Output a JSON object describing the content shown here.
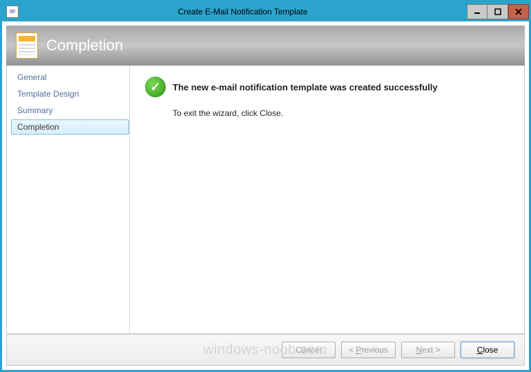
{
  "window": {
    "title": "Create E-Mail Notification Template"
  },
  "banner": {
    "title": "Completion"
  },
  "sidebar": {
    "items": [
      {
        "label": "General",
        "active": false
      },
      {
        "label": "Template Design",
        "active": false
      },
      {
        "label": "Summary",
        "active": false
      },
      {
        "label": "Completion",
        "active": true
      }
    ]
  },
  "content": {
    "heading": "The new e-mail notification template was created successfully",
    "body": "To exit the wizard, click Close."
  },
  "footer": {
    "cancel": "Cancel",
    "previous_prefix": "< ",
    "previous_u": "P",
    "previous_suffix": "revious",
    "next_u": "N",
    "next_suffix": "ext >",
    "close_u": "C",
    "close_suffix": "lose"
  },
  "watermark": "windows-noob.com"
}
